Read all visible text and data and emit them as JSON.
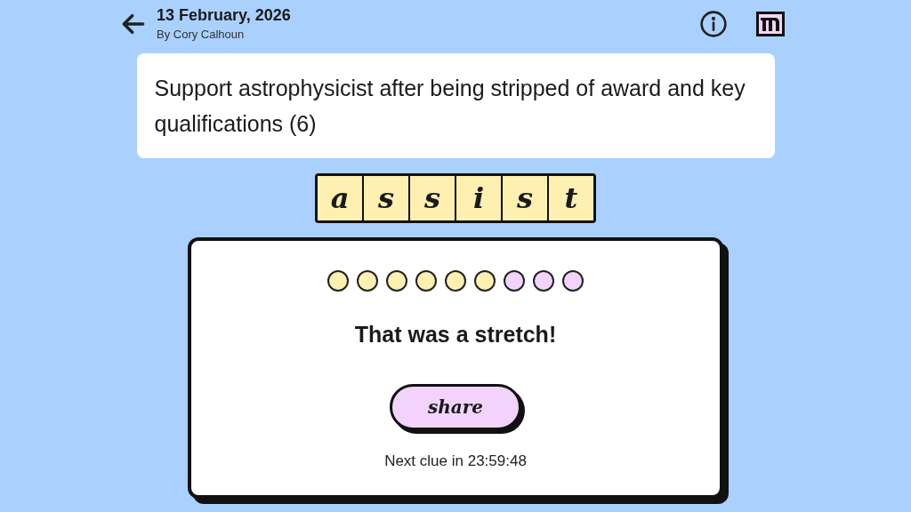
{
  "header": {
    "date": "13 February, 2026",
    "byline": "By Cory Calhoun"
  },
  "clue": {
    "text": "Support astrophysicist after being stripped of award and key qualifications (6)"
  },
  "answer": [
    {
      "letter": "a"
    },
    {
      "letter": "s"
    },
    {
      "letter": "s"
    },
    {
      "letter": "i"
    },
    {
      "letter": "s"
    },
    {
      "letter": "t"
    }
  ],
  "result": {
    "dots": [
      {
        "color": "#fdf0b0"
      },
      {
        "color": "#fdf0b0"
      },
      {
        "color": "#fdf0b0"
      },
      {
        "color": "#fdf0b0"
      },
      {
        "color": "#fdf0b0"
      },
      {
        "color": "#fdf0b0"
      },
      {
        "color": "#f3d3fb"
      },
      {
        "color": "#f3d3fb"
      },
      {
        "color": "#f3d3fb"
      }
    ],
    "message": "That was a stretch!",
    "share_label": "share",
    "countdown": "Next clue in 23:59:48"
  }
}
